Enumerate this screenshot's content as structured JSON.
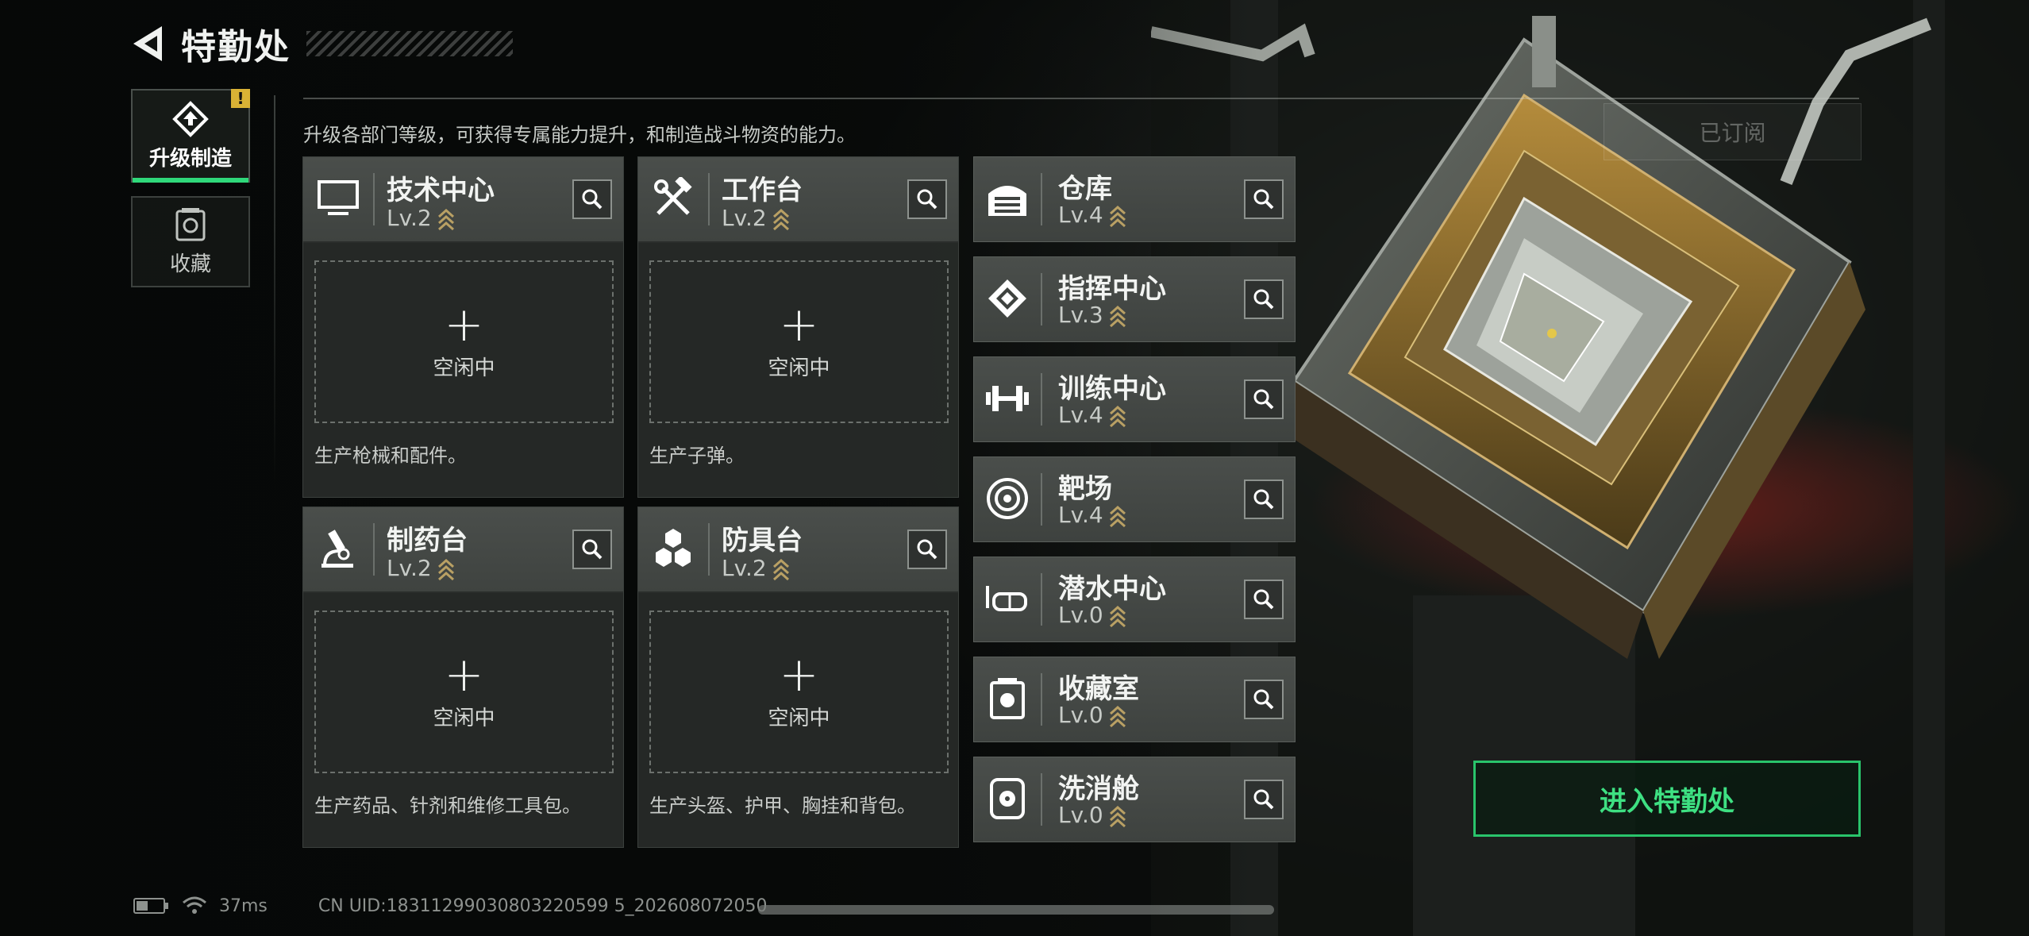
{
  "header": {
    "title": "特勤处"
  },
  "nav": {
    "tabs": [
      {
        "label": "升级制造",
        "active": true,
        "alert": "!"
      },
      {
        "label": "收藏",
        "active": false
      }
    ]
  },
  "description": "升级各部门等级，可获得专属能力提升，和制造战斗物资的能力。",
  "production": [
    {
      "name": "技术中心",
      "level": "Lv.2",
      "icon": "monitor-icon",
      "slot_label": "空闲中",
      "desc": "生产枪械和配件。"
    },
    {
      "name": "工作台",
      "level": "Lv.2",
      "icon": "tools-icon",
      "slot_label": "空闲中",
      "desc": "生产子弹。"
    },
    {
      "name": "制药台",
      "level": "Lv.2",
      "icon": "microscope-icon",
      "slot_label": "空闲中",
      "desc": "生产药品、针剂和维修工具包。"
    },
    {
      "name": "防具台",
      "level": "Lv.2",
      "icon": "hexagons-icon",
      "slot_label": "空闲中",
      "desc": "生产头盔、护甲、胸挂和背包。"
    }
  ],
  "facilities": [
    {
      "name": "仓库",
      "level": "Lv.4",
      "icon": "warehouse-icon"
    },
    {
      "name": "指挥中心",
      "level": "Lv.3",
      "icon": "chip-icon"
    },
    {
      "name": "训练中心",
      "level": "Lv.4",
      "icon": "dumbbell-icon"
    },
    {
      "name": "靶场",
      "level": "Lv.4",
      "icon": "target-icon"
    },
    {
      "name": "潜水中心",
      "level": "Lv.0",
      "icon": "diving-mask-icon"
    },
    {
      "name": "收藏室",
      "level": "Lv.0",
      "icon": "collection-icon"
    },
    {
      "name": "洗消舱",
      "level": "Lv.0",
      "icon": "decontamination-icon"
    }
  ],
  "subscribe_label": "已订阅",
  "enter_button": "进入特勤处",
  "status": {
    "ping": "37ms",
    "uid": "CN UID:18311299030803220599 5_202608072050"
  },
  "colors": {
    "accent": "#2fd87a",
    "alert": "#d9b235",
    "level_chevron": "#b9a064"
  }
}
